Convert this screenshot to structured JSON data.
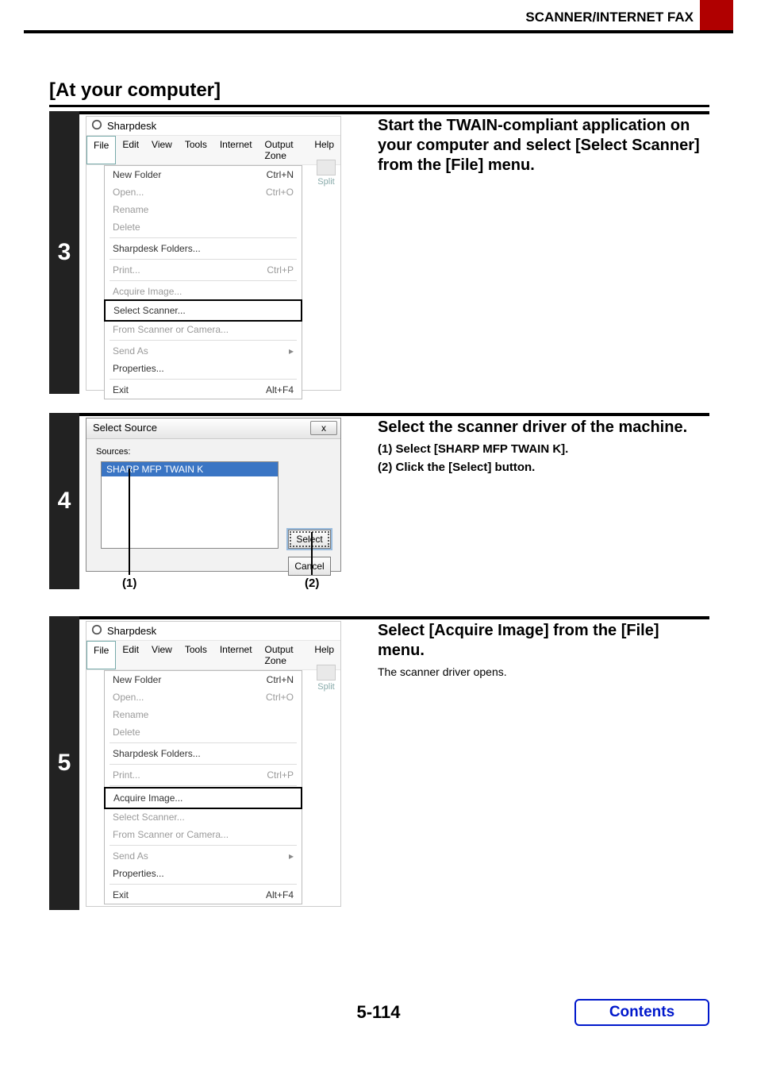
{
  "header": {
    "title": "SCANNER/INTERNET FAX"
  },
  "section_title": "[At your computer]",
  "app": {
    "title": "Sharpdesk",
    "menubar": [
      "File",
      "Edit",
      "View",
      "Tools",
      "Internet",
      "Output Zone",
      "Help"
    ],
    "side_label": "Split",
    "menu": {
      "new_folder": "New Folder",
      "new_folder_sc": "Ctrl+N",
      "open": "Open...",
      "open_sc": "Ctrl+O",
      "rename": "Rename",
      "delete": "Delete",
      "sd_folders": "Sharpdesk Folders...",
      "print": "Print...",
      "print_sc": "Ctrl+P",
      "acquire": "Acquire Image...",
      "select_scanner": "Select Scanner...",
      "from_scanner": "From Scanner or Camera...",
      "send_as": "Send As",
      "properties": "Properties...",
      "exit": "Exit",
      "exit_sc": "Alt+F4"
    }
  },
  "step3": {
    "num": "3",
    "title": "Start the TWAIN-compliant application on your computer and select [Select Scanner] from the [File] menu."
  },
  "step4": {
    "num": "4",
    "title": "Select the scanner driver of the machine.",
    "li1": "(1)  Select [SHARP MFP TWAIN K].",
    "li2": "(2)  Click the [Select] button.",
    "dialog": {
      "title": "Select Source",
      "group": "Sources:",
      "item": "SHARP MFP TWAIN K",
      "select": "Select",
      "cancel": "Cancel",
      "close_x": "x"
    },
    "cl1": "(1)",
    "cl2": "(2)"
  },
  "step5": {
    "num": "5",
    "title": "Select [Acquire Image] from the [File] menu.",
    "body": "The scanner driver opens."
  },
  "footer": {
    "page": "5-114",
    "contents": "Contents"
  }
}
